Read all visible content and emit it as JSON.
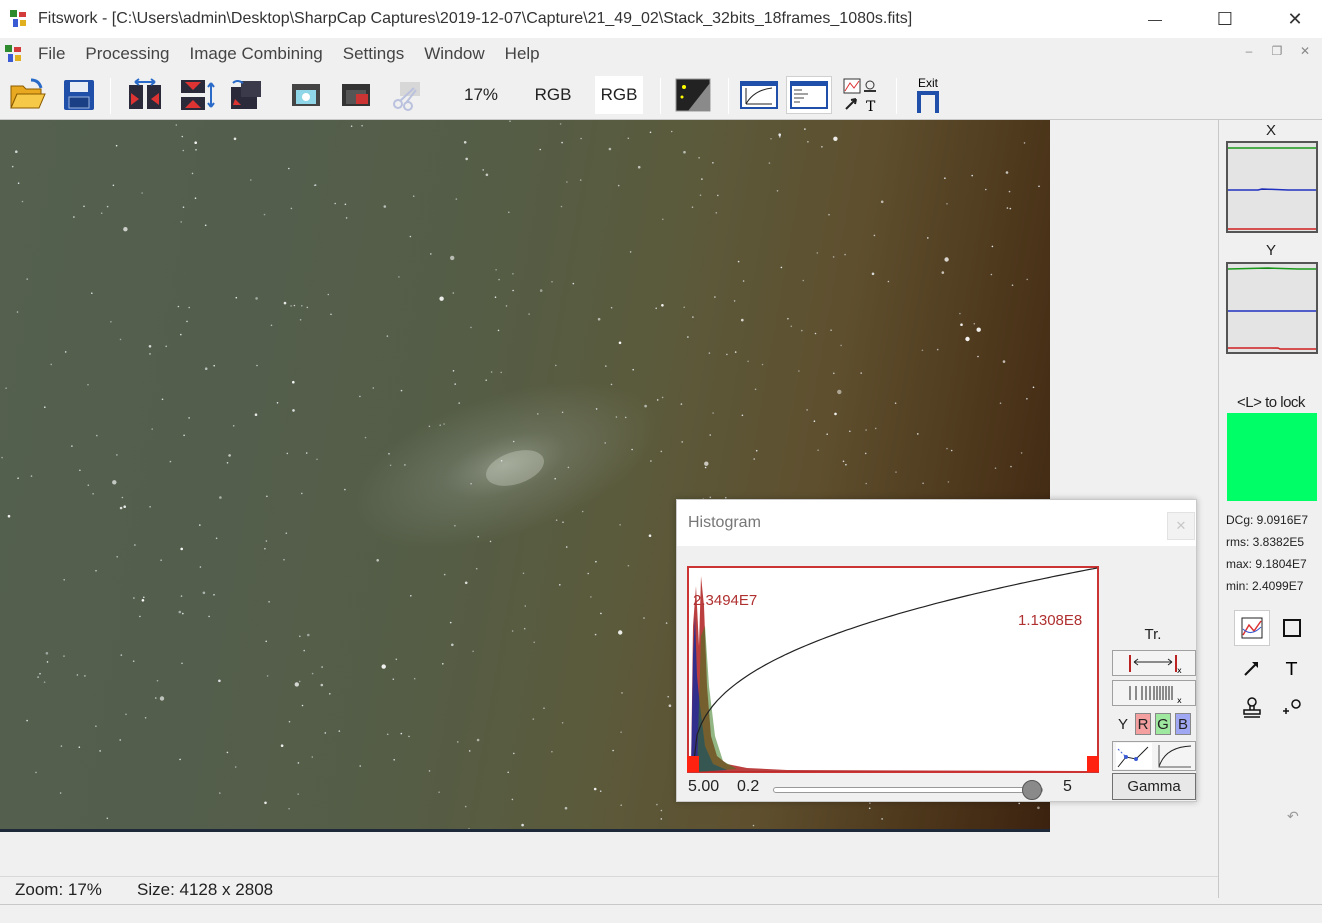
{
  "window": {
    "title": "Fitswork - [C:\\Users\\admin\\Desktop\\SharpCap Captures\\2019-12-07\\Capture\\21_49_02\\Stack_32bits_18frames_1080s.fits]",
    "minimize_glyph": "—",
    "maximize_glyph": "☐",
    "close_glyph": "✕"
  },
  "menu": {
    "items": [
      "File",
      "Processing",
      "Image Combining",
      "Settings",
      "Window",
      "Help"
    ]
  },
  "mdi_controls": {
    "minimize": "–",
    "restore": "❐",
    "close": "✕"
  },
  "toolbar": {
    "zoom_label": "17%",
    "rgb_label_1": "RGB",
    "rgb_label_2": "RGB",
    "exit_label": "Exit"
  },
  "histogram": {
    "title": "Histogram",
    "close_glyph": "✕",
    "left_value": "2.3494E7",
    "right_value": "1.1308E8",
    "gamma_value": "5.00",
    "slider_min": "0.2",
    "slider_max": "5",
    "slider_position": 0.96,
    "tr_label": "Tr.",
    "channels": {
      "y": "Y",
      "r": "R",
      "g": "G",
      "b": "B"
    },
    "gamma_button": "Gamma"
  },
  "side_panel": {
    "x_label": "X",
    "y_label": "Y",
    "lock_label": "<L> to lock",
    "swatch_color": "#00ff66",
    "stats": {
      "dcg": "DCg: 9.0916E7",
      "rms": "rms: 3.8382E5",
      "max": "max: 9.1804E7",
      "min": "min: 2.4099E7"
    }
  },
  "status": {
    "zoom": "Zoom: 17%",
    "size": "Size: 4128 x 2808"
  }
}
